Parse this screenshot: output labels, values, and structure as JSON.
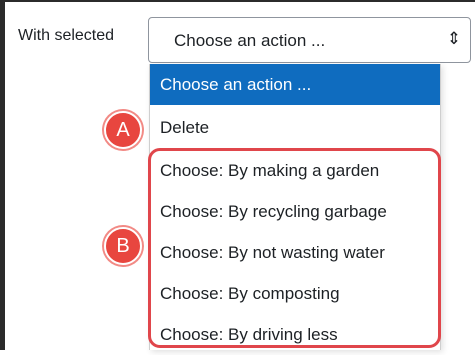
{
  "form": {
    "with_selected_label": "With selected",
    "select_value": "Choose an action ...",
    "select_arrow": "⇕",
    "options": [
      "Choose an action ...",
      "Delete",
      "Choose: By making a garden",
      "Choose: By recycling garbage",
      "Choose: By not wasting water",
      "Choose: By composting",
      "Choose: By driving less"
    ]
  },
  "annotations": {
    "badge_a": "A",
    "badge_b": "B"
  },
  "colors": {
    "selected_option_background": "#0f6cbf",
    "annotation_red": "#e8463f"
  }
}
